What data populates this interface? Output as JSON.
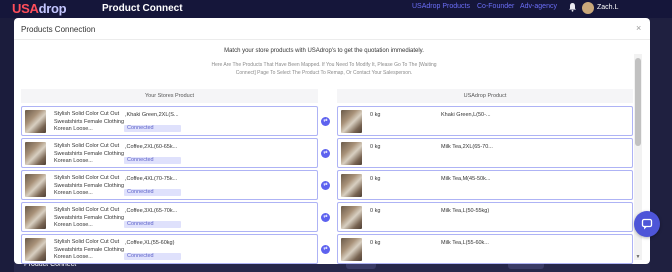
{
  "app": {
    "logo_main": "USA",
    "logo_rest": "drop",
    "page_title": "Product Connect",
    "nav_links": [
      "USAdrop Products",
      "Co-Founder",
      "Adv-agency"
    ],
    "user_name": "Zach.L",
    "bottom_label": "Product Connect"
  },
  "modal": {
    "title": "Products Connection",
    "close_glyph": "×",
    "intro": "Match your store products with USAdrop's to get the quotation immediately.",
    "note": "Here Are The Products That Have Been Mapped. If You Need To Modify It, Please Go To The [Waiting Connect] Page To Select The Product To Remap, Or Contact Your Salesperson.",
    "store_header": "Your Stores Product",
    "usa_header": "USAdrop Product",
    "link_glyph": "⇄",
    "scroll_down": "▼",
    "rows": [
      {
        "store_name": "Stylish Solid Color Cut Out Sweatshirts Female Clothing Korean Loose...",
        "store_variant": ",Khaki Green,2XL(S...",
        "status": "Connected",
        "weight": "0 kg",
        "usa_variant": "Khaki Green,L(50-..."
      },
      {
        "store_name": "Stylish Solid Color Cut Out Sweatshirts Female Clothing Korean Loose...",
        "store_variant": ",Coffee,2XL(60-65k...",
        "status": "Connected",
        "weight": "0 kg",
        "usa_variant": "Milk Tea,2XL(65-70..."
      },
      {
        "store_name": "Stylish Solid Color Cut Out Sweatshirts Female Clothing Korean Loose...",
        "store_variant": ",Coffee,4XL(70-75k...",
        "status": "Connected",
        "weight": "0 kg",
        "usa_variant": "Milk Tea,M(45-50k..."
      },
      {
        "store_name": "Stylish Solid Color Cut Out Sweatshirts Female Clothing Korean Loose...",
        "store_variant": ",Coffee,3XL(65-70k...",
        "status": "Connected",
        "weight": "0 kg",
        "usa_variant": "Milk Tea,L(50-55kg)"
      },
      {
        "store_name": "Stylish Solid Color Cut Out Sweatshirts Female Clothing Korean Loose...",
        "store_variant": ",Coffee,XL(55-60kg)",
        "status": "Connected",
        "weight": "0 kg",
        "usa_variant": "Milk Tea,L(55-60k..."
      }
    ]
  },
  "colors": {
    "accent": "#5d62ef",
    "card_border": "#aeb3f5",
    "badge_bg": "#dfe1fc",
    "logo_red": "#ff4d5a",
    "nav_link": "#6b6ef7"
  },
  "icons": {
    "bell": "bell-icon",
    "link": "link-icon",
    "chat": "chat-icon",
    "close": "close-icon"
  }
}
